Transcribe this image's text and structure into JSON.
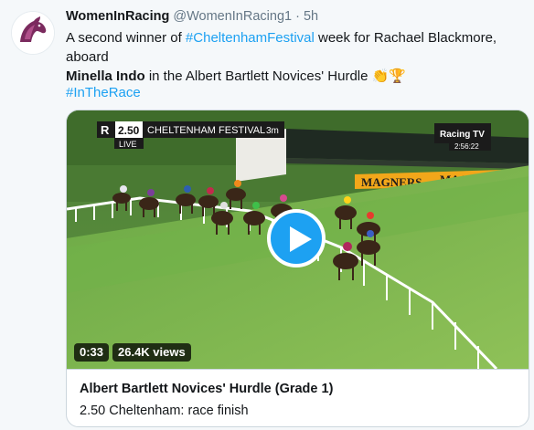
{
  "tweet": {
    "author_name": "WomenInRacing",
    "author_handle": "@WomenInRacing1",
    "separator": "·",
    "time": "5h",
    "text_part1": "A second winner of ",
    "hashtag_festival": "#CheltenhamFestival",
    "text_part2": " week for Rachael Blackmore, aboard",
    "horse_name": "Minella Indo",
    "text_part3": " in the Albert Bartlett Novices' Hurdle ",
    "emoji_clap": "👏",
    "emoji_trophy": "🏆",
    "hashtag_race": "#InTheRace"
  },
  "video": {
    "race_time": "2.50",
    "meeting": "CHELTENHAM FESTIVAL",
    "distance": "3m",
    "live_label": "LIVE",
    "channel": "Racing TV",
    "clock": "2:56:22",
    "sponsor": "MAGNERS",
    "duration": "0:33",
    "views": "26.4K views"
  },
  "card": {
    "title": "Albert Bartlett Novices' Hurdle (Grade 1)",
    "description": "2.50 Cheltenham: race finish"
  },
  "colors": {
    "link": "#1da1f2",
    "avatar_brand": "#7b2a5e",
    "play_button": "#1da1f2"
  }
}
